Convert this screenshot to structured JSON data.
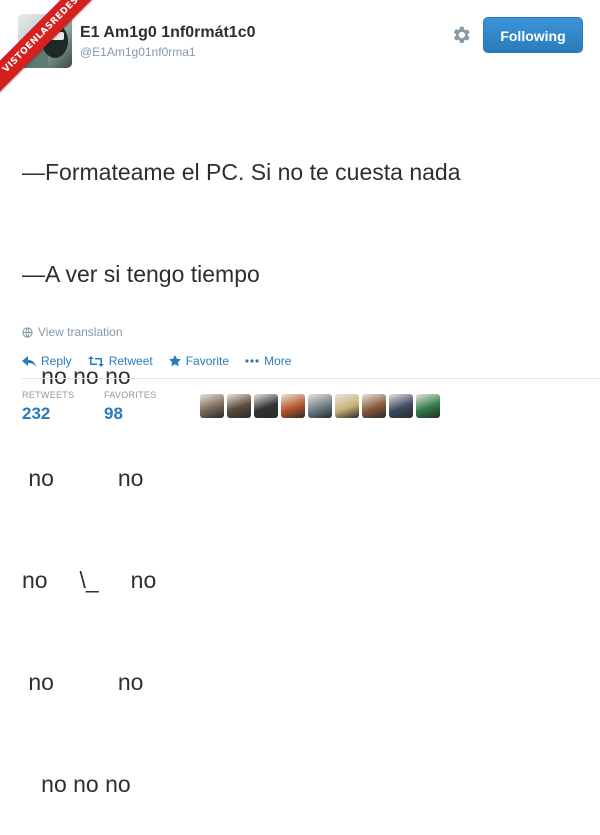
{
  "watermark": {
    "text": "VISTOENLASREDES"
  },
  "user": {
    "display_name": "E1 Am1g0 1nf0rmát1c0",
    "handle": "@E1Am1g01nf0rma1"
  },
  "follow_button": {
    "label": "Following",
    "color": "#2b7bb9"
  },
  "tweet": {
    "lines": [
      "—Formateame el PC. Si no te cuesta nada",
      "—A ver si tengo tiempo",
      "   no no no",
      " no          no",
      "no     \\_     no",
      " no          no",
      "   no no no"
    ]
  },
  "translate": {
    "label": "View translation",
    "icon": "globe-icon"
  },
  "actions": {
    "reply": "Reply",
    "retweet": "Retweet",
    "favorite": "Favorite",
    "more": "More"
  },
  "stats": {
    "retweets_label": "RETWEETS",
    "retweets_value": "232",
    "favorites_label": "FAVORITES",
    "favorites_value": "98"
  },
  "colors": {
    "link": "#2b7bb9",
    "muted": "#8899a6",
    "text": "#292f33",
    "ribbon": "#d62020"
  },
  "favoriters": [
    {
      "color": "#7a6a5a"
    },
    {
      "color": "#5a4a3c"
    },
    {
      "color": "#333333"
    },
    {
      "color": "#b8562a"
    },
    {
      "color": "#6b7e86"
    },
    {
      "color": "#c9b27a"
    },
    {
      "color": "#8a5a3a"
    },
    {
      "color": "#3e4a63"
    },
    {
      "color": "#2e7d4a"
    }
  ]
}
